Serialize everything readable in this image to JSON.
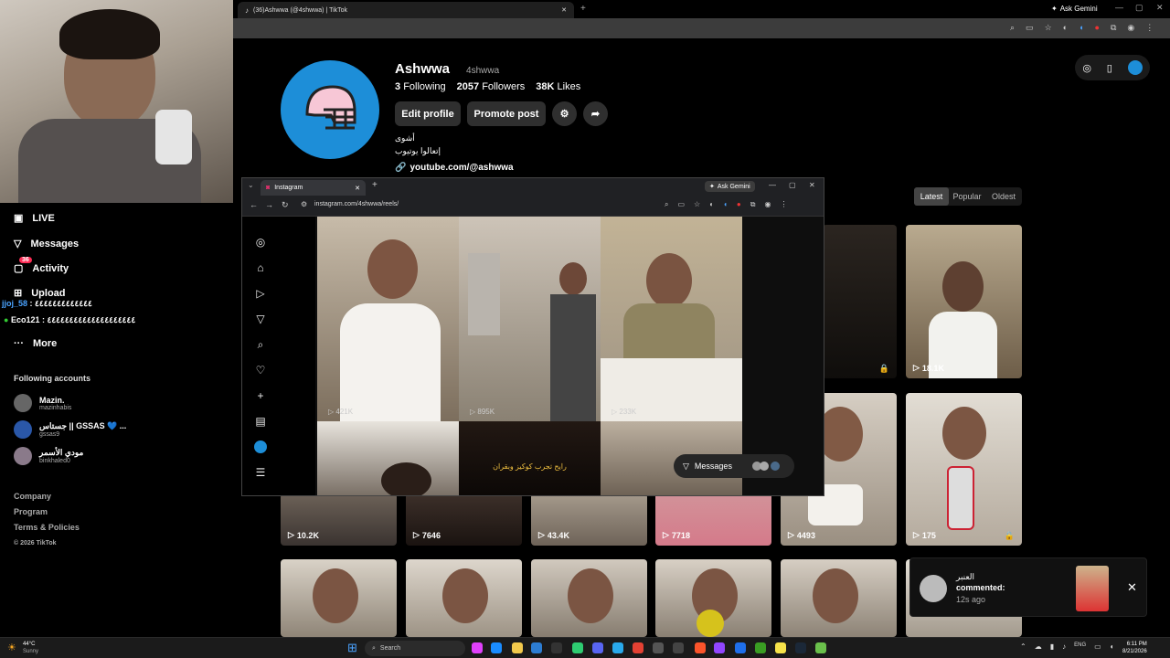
{
  "browser": {
    "tab_title": "(36)Ashwwa (@4shwwa) | TikTok",
    "ask_gemini": "Ask Gemini"
  },
  "profile": {
    "name": "Ashwwa",
    "username": "4shwwa",
    "following_count": "3",
    "following_label": "Following",
    "followers_count": "2057",
    "followers_label": "Followers",
    "likes_count": "38K",
    "likes_label": "Likes",
    "edit_profile": "Edit profile",
    "promote_post": "Promote post",
    "bio_line1": "أشوى",
    "bio_line2": "إتعالوا يوتيوب",
    "link": "youtube.com/@ashwwa"
  },
  "sort_tabs": [
    "Latest",
    "Popular",
    "Oldest"
  ],
  "videos": [
    {
      "count": "18.1K"
    },
    {
      "count": "10.2K"
    },
    {
      "count": "7646"
    },
    {
      "count": "43.4K"
    },
    {
      "count": "7718"
    },
    {
      "count": "4493"
    },
    {
      "count": "175"
    }
  ],
  "sidebar": {
    "items": [
      {
        "label": "LIVE",
        "icon": "live-icon"
      },
      {
        "label": "Messages",
        "icon": "messages-icon"
      },
      {
        "label": "Activity",
        "icon": "activity-icon",
        "badge": "36"
      },
      {
        "label": "Upload",
        "icon": "upload-icon"
      },
      {
        "label": "More",
        "icon": "more-icon"
      }
    ],
    "following_heading": "Following accounts",
    "following": [
      {
        "name": "Mazin.",
        "handle": "mazinhabis"
      },
      {
        "name": "جستاس || GSSAS 💙 ...",
        "handle": "gssas9"
      },
      {
        "name": "مودي الأسمر",
        "handle": "binkhaled0"
      }
    ],
    "footer": [
      "Company",
      "Program",
      "Terms & Policies",
      "© 2026 TikTok"
    ]
  },
  "chat": [
    {
      "user": "jjoj_58",
      "text": ": ٤٤٤٤٤٤٤٤٤٤٤٤٤"
    },
    {
      "user": "Eco121",
      "text": ": ٤٤٤٤٤٤٤٤٤٤٤٤٤٤٤٤٤٤٤٤"
    }
  ],
  "instagram": {
    "tab_title": "Instagram",
    "url": "instagram.com/4shwwa/reels/",
    "ask_gemini": "Ask Gemini",
    "reel_counts": [
      "421K",
      "895K",
      "233K"
    ],
    "reel_caption": "رايح تجرب كوكيز وبقران",
    "messages_label": "Messages"
  },
  "notification": {
    "user": "العنبر",
    "text": "commented:",
    "time": "12s ago"
  },
  "taskbar": {
    "weather_temp": "44°C",
    "weather_desc": "Sunny",
    "search": "Search",
    "lang": "ENG",
    "time": "6:11 PM",
    "date": "8/21/2026"
  },
  "colors": {
    "accent": "#1d8ed8",
    "badge": "#fe2c55"
  }
}
